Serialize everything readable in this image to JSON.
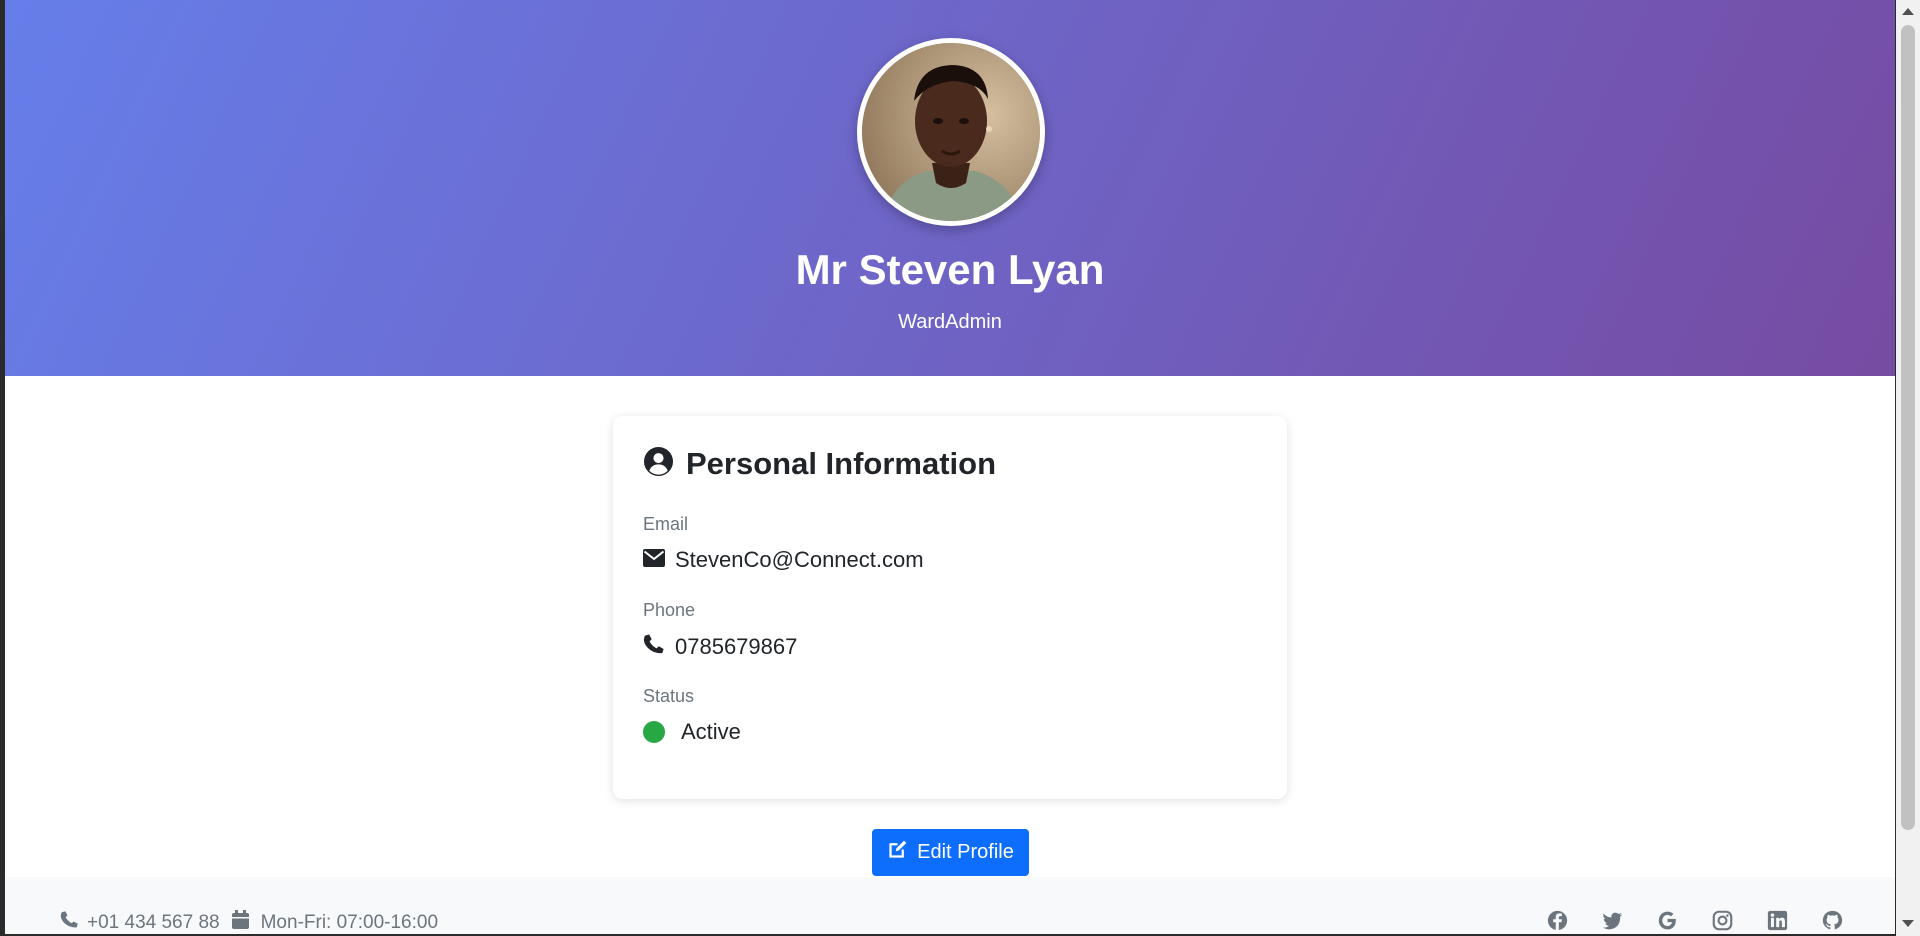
{
  "profile": {
    "name": "Mr Steven Lyan",
    "role": "WardAdmin"
  },
  "card": {
    "title": "Personal Information",
    "title_icon": "user-circle-icon",
    "fields": [
      {
        "label": "Email",
        "value": "StevenCo@Connect.com",
        "icon": "envelope-icon"
      },
      {
        "label": "Phone",
        "value": "0785679867",
        "icon": "phone-icon"
      },
      {
        "label": "Status",
        "value": "Active",
        "icon": "status-dot",
        "color": "#28a745"
      }
    ]
  },
  "actions": {
    "edit_label": "Edit Profile",
    "edit_icon": "pen-to-square-icon"
  },
  "footer": {
    "phone": "+01 434 567 88",
    "hours": "Mon-Fri: 07:00-16:00",
    "social": [
      "facebook-icon",
      "twitter-icon",
      "google-icon",
      "instagram-icon",
      "linkedin-icon",
      "github-icon"
    ]
  },
  "colors": {
    "hero_start": "#667eea",
    "hero_end": "#764ba2",
    "accent": "#0d6efd",
    "status_active": "#28a745"
  }
}
